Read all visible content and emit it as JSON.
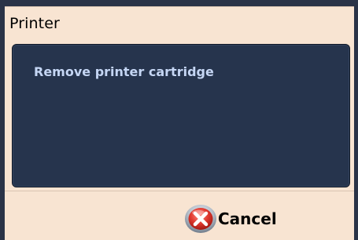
{
  "dialog": {
    "title": "Printer",
    "message": "Remove printer cartridge",
    "cancel_label": "Cancel",
    "cancel_icon": "cancel-x-icon"
  },
  "colors": {
    "dialog_bg": "#f8e4d2",
    "panel_bg": "#26344d",
    "message_text": "#c5d6f4",
    "icon_red": "#d7322b",
    "icon_ring": "#8e9aa9"
  }
}
